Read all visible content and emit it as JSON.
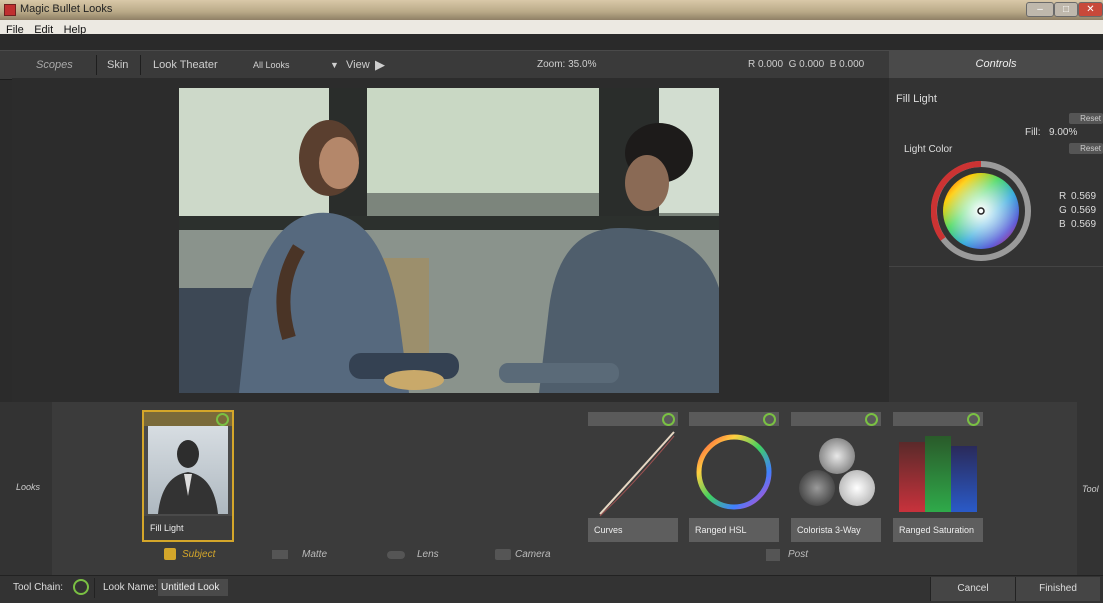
{
  "window": {
    "title": "Magic Bullet Looks"
  },
  "menu": [
    "File",
    "Edit",
    "Help"
  ],
  "toolbar": {
    "scopes": "Scopes",
    "skin": "Skin",
    "look_theater": "Look Theater",
    "all_looks": "All Looks",
    "view": "View",
    "zoom": "Zoom: 35.0%",
    "rgb_readout": "R 0.000  G 0.000  B 0.000",
    "controls": "Controls"
  },
  "controls_panel": {
    "tool_name": "Fill Light",
    "reset": "Reset",
    "fill_label": "Fill:",
    "fill_value": "9.00%",
    "light_color_label": "Light Color",
    "r_label": "R",
    "r_value": "0.569",
    "g_label": "G",
    "g_value": "0.569",
    "b_label": "B",
    "b_value": "0.569"
  },
  "looks": {
    "side_label": "Looks",
    "right_label": "Tool",
    "subject_tile": "Fill Light",
    "tools": [
      "Curves",
      "Ranged HSL",
      "Colorista 3-Way",
      "Ranged Saturation"
    ],
    "categories": [
      "Subject",
      "Matte",
      "Lens",
      "Camera",
      "Post"
    ]
  },
  "status": {
    "tool_chain": "Tool Chain:",
    "look_name_label": "Look Name:",
    "look_name_value": "Untitled Look",
    "cancel": "Cancel",
    "finished": "Finished"
  },
  "colors": {
    "accent_gold": "#d4a62a",
    "power_green": "#7ac043",
    "saturation_red": "#c8323c",
    "saturation_green": "#2faa4a",
    "saturation_blue": "#2a5ac8"
  }
}
